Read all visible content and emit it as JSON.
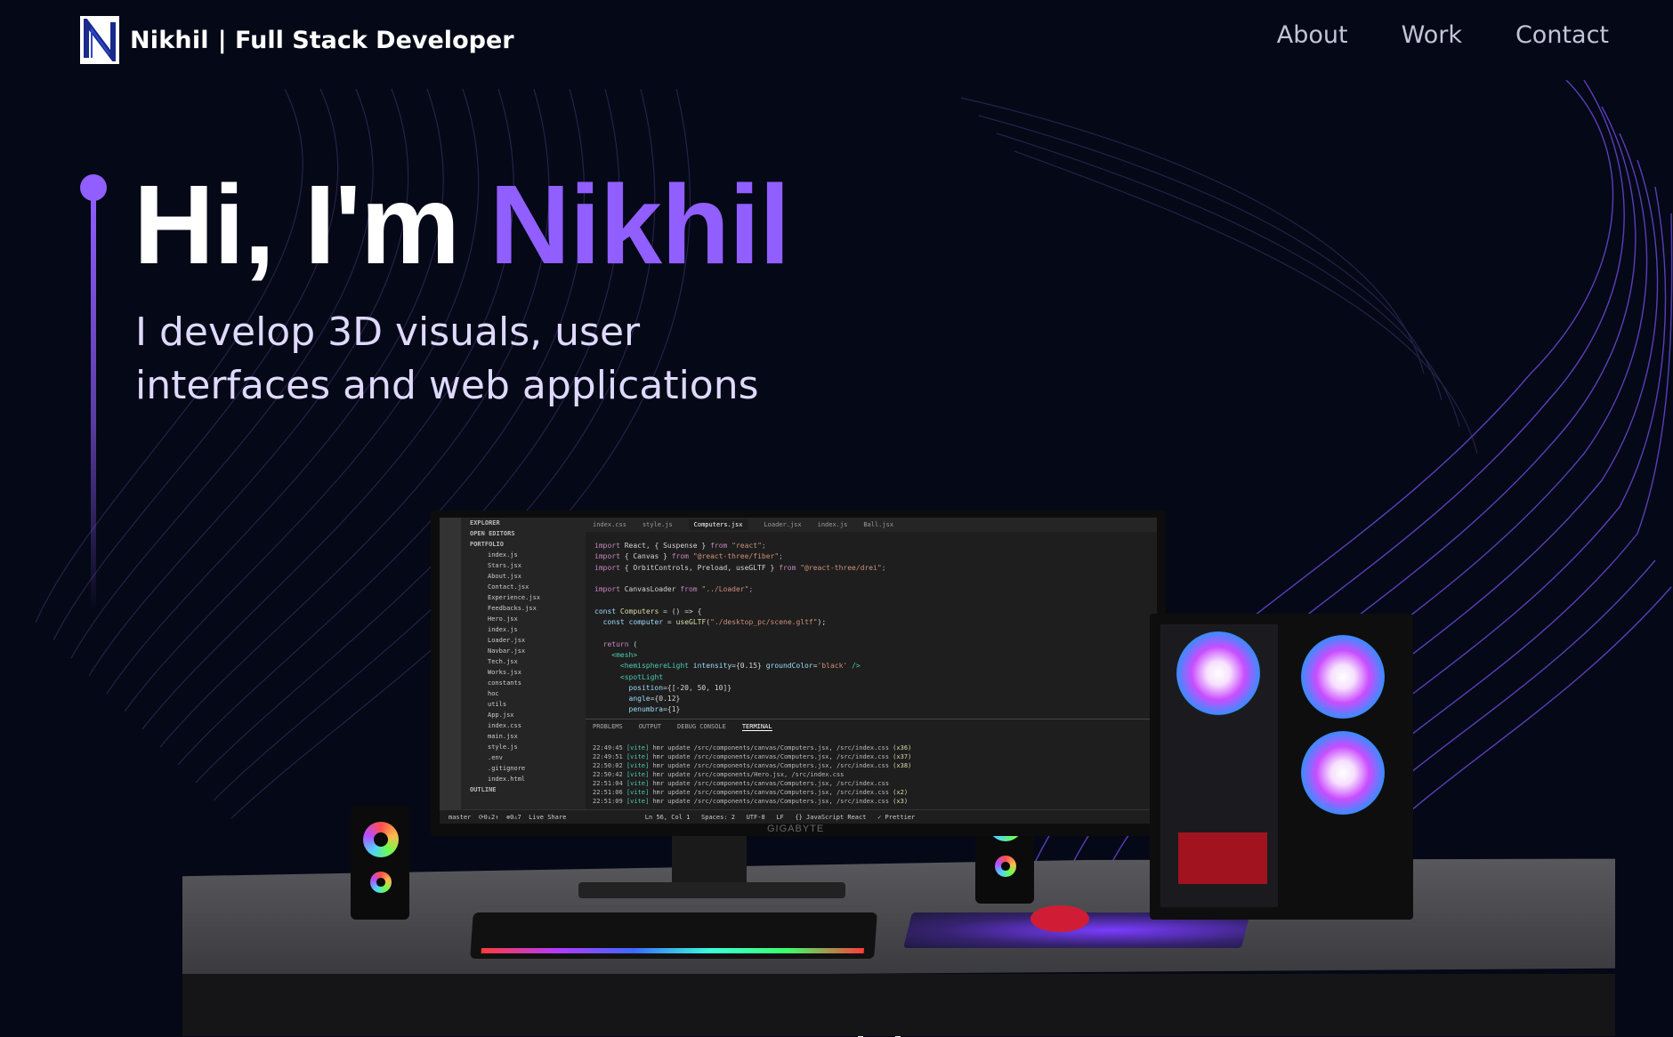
{
  "nav": {
    "brand_name": "Nikhil",
    "brand_tagline": "| Full Stack Developer",
    "links": [
      "About",
      "Work",
      "Contact"
    ]
  },
  "hero": {
    "greeting": "Hi, I'm",
    "name": "Nikhil",
    "subtitle": "I develop 3D visuals, user interfaces and web applications"
  },
  "monitor": {
    "brand": "GIGABYTE",
    "tabs": [
      "index.css",
      "style.js",
      "Computers.jsx",
      "Loader.jsx",
      "index.js",
      "Ball.jsx"
    ],
    "explorer_header": "EXPLORER",
    "open_editors": "OPEN EDITORS",
    "project": "PORTFOLIO",
    "files": [
      "index.js",
      "Stars.jsx",
      "About.jsx",
      "Contact.jsx",
      "Experience.jsx",
      "Feedbacks.jsx",
      "Hero.jsx",
      "index.js",
      "Loader.jsx",
      "Navbar.jsx",
      "Tech.jsx",
      "Works.jsx",
      "constants",
      "hoc",
      "utils",
      "App.jsx",
      "index.css",
      "main.jsx",
      "style.js",
      ".env",
      ".gitignore",
      "index.html"
    ],
    "outline": "OUTLINE",
    "panel_tabs": [
      "PROBLEMS",
      "OUTPUT",
      "DEBUG CONSOLE",
      "TERMINAL"
    ],
    "status": "master  ⟳0↓2↑  ⊗0⚠7  Live Share                     Ln 56, Col 1   Spaces: 2   UTF-8   LF   {} JavaScript React   ✓ Prettier"
  },
  "colors": {
    "background": "#050816",
    "accent": "#915eff",
    "nav_link": "#c4c3d8",
    "subtitle": "#dfd9ff"
  }
}
